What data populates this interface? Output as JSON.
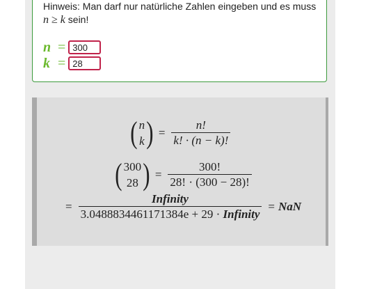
{
  "hint": {
    "text": "Hinweis: Man darf nur natürliche Zahlen eingeben und es muss",
    "condition": "n ≥ k",
    "suffix": "sein!"
  },
  "inputs": {
    "n_label": "n",
    "n_value": "300",
    "k_label": "k",
    "k_value": "28",
    "equals": "="
  },
  "formula": {
    "line1": {
      "top": "n",
      "bottom": "k",
      "num": "n!",
      "den": "k! · (n − k)!"
    },
    "line2": {
      "top": "300",
      "bottom": "28",
      "num": "300!",
      "den": "28! · (300 − 28)!"
    },
    "line3": {
      "num": "Infinity",
      "den_prefix": "3.0488834461171384e + 29 · ",
      "den_inf": "Infinity",
      "result": "NaN"
    }
  }
}
